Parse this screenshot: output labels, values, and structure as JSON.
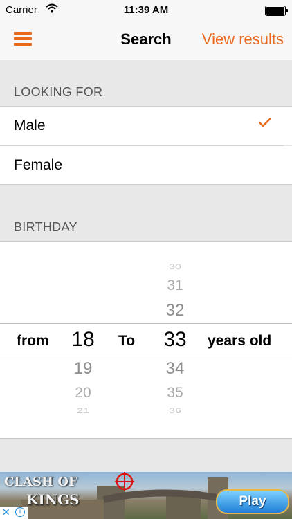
{
  "status_bar": {
    "carrier": "Carrier",
    "time": "11:39 AM"
  },
  "nav": {
    "title": "Search",
    "action": "View results",
    "menu_icon": "hamburger-icon"
  },
  "looking_for": {
    "header": "LOOKING FOR",
    "options": [
      {
        "label": "Male",
        "selected": true
      },
      {
        "label": "Female",
        "selected": false
      }
    ]
  },
  "birthday": {
    "header": "BIRTHDAY",
    "from_label": "from",
    "to_label": "To",
    "suffix_label": "years old",
    "from_selected": "18",
    "from_after": [
      "19",
      "20",
      "21"
    ],
    "to_before": [
      "30",
      "31",
      "32"
    ],
    "to_selected": "33",
    "to_after": [
      "34",
      "35",
      "36"
    ]
  },
  "ad": {
    "game_title_line1": "CLASH OF",
    "game_title_line2": "KINGS",
    "play_label": "Play"
  },
  "colors": {
    "accent": "#e8691e",
    "background": "#e8e8e8"
  }
}
